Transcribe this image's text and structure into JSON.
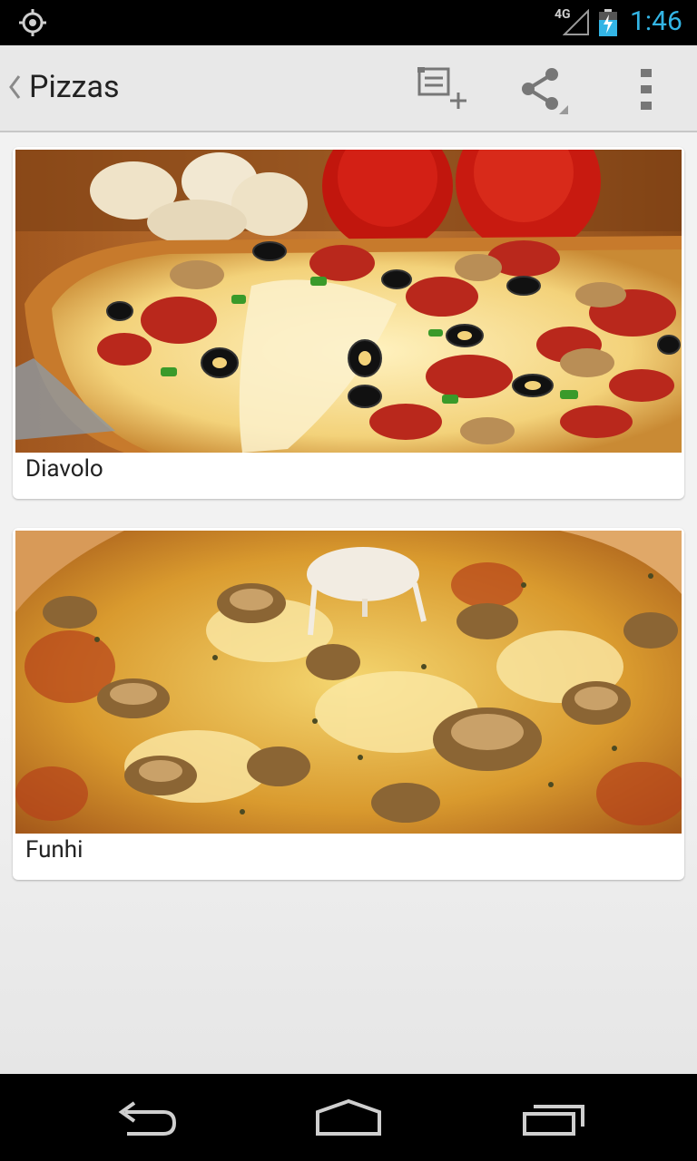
{
  "status_bar": {
    "network": "4G",
    "time": "1:46",
    "icons": [
      "gps-icon",
      "signal-icon",
      "battery-charging-icon"
    ]
  },
  "action_bar": {
    "title": "Pizzas",
    "actions": [
      "new-item-icon",
      "share-icon",
      "overflow-menu-icon"
    ]
  },
  "pizzas": [
    {
      "name": "Diavolo",
      "image": "pizza-diavolo-photo"
    },
    {
      "name": "Funhi",
      "image": "pizza-funhi-photo"
    }
  ],
  "nav_bar": {
    "buttons": [
      "back-icon",
      "home-icon",
      "recent-apps-icon"
    ]
  },
  "colors": {
    "clock": "#33b5e5",
    "action_bar_bg": "#e8e8e8",
    "content_bg": "#f2f2f2"
  }
}
